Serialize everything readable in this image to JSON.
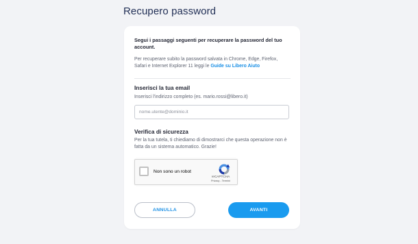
{
  "page": {
    "title": "Recupero password"
  },
  "intro": {
    "heading": "Segui i passaggi seguenti per recuperare la password del tuo account.",
    "text": "Per recuperare subito la password salvata in Chrome, Edge, Firefox, Safari e Internet Explorer 11 leggi le ",
    "link_label": "Guide su Libero Aiuto"
  },
  "email_section": {
    "title": "Inserisci la tua email",
    "hint": "Inserisci l'indirizzo completo (es. mario.rossi@libero.it)",
    "input_value": "",
    "input_placeholder": "nome.utente@dominio.it"
  },
  "security_section": {
    "title": "Verifica di sicurezza",
    "text": "Per la tua tutela, ti chiediamo di dimostrarci che questa operazione non è fatta da un sistema automatico. Grazie!"
  },
  "recaptcha": {
    "label": "Non sono un robot",
    "brand": "reCAPTCHA",
    "links": "Privacy - Termini",
    "checked": false,
    "icon": "recaptcha-logo-icon"
  },
  "buttons": {
    "cancel_label": "ANNULLA",
    "next_label": "AVANTI"
  },
  "colors": {
    "accent": "#1a9bef",
    "link": "#1a8fe5",
    "title": "#1f2d54",
    "background": "#f2f3f6"
  }
}
